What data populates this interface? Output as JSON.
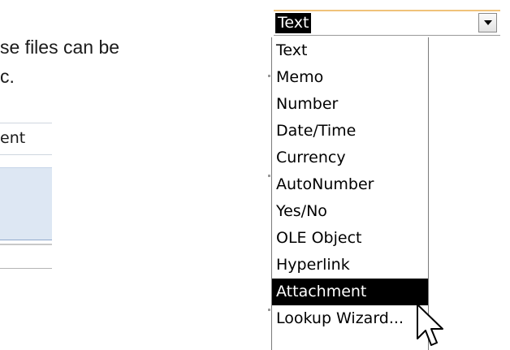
{
  "document": {
    "lines": [
      "se files can be",
      "c."
    ]
  },
  "table": {
    "header": "ent"
  },
  "field_type_combo": {
    "value": "Text",
    "button_icon": "dropdown-arrow-icon"
  },
  "dropdown": {
    "items": [
      "Text",
      "Memo",
      "Number",
      "Date/Time",
      "Currency",
      "AutoNumber",
      "Yes/No",
      "OLE Object",
      "Hyperlink",
      "Attachment",
      "Lookup Wizard..."
    ],
    "selected": "Attachment"
  },
  "colors": {
    "selection_bg": "#000000",
    "selection_fg": "#ffffff",
    "grid_row_bg": "#dde7f3",
    "combo_accent": "#f0c27a"
  },
  "cursor_icon": "mouse-pointer-icon"
}
